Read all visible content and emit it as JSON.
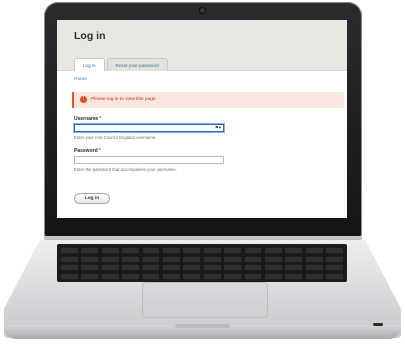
{
  "page": {
    "title": "Log in",
    "tabs": [
      {
        "label": "Log in",
        "active": true
      },
      {
        "label": "Reset your password",
        "active": false
      }
    ],
    "breadcrumb": "Home",
    "alert": {
      "text": "Please log in to view this page",
      "icon": "error-icon",
      "color": "#e2542c"
    }
  },
  "form": {
    "username": {
      "label": "Username",
      "required": "*",
      "value": "",
      "icons": "⚑▾",
      "description": "Enter your Arts Council England username."
    },
    "password": {
      "label": "Password",
      "required": "*",
      "value": "",
      "description": "Enter the password that accompanies your username."
    },
    "submit_label": "Log in"
  },
  "colors": {
    "link": "#3f6f9f",
    "header_bg": "#e8e8e2",
    "required": "#d23c1f"
  }
}
